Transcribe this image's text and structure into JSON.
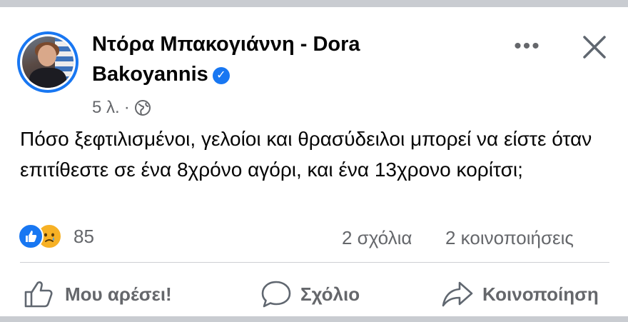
{
  "post": {
    "author_name": "Ντόρα Μπακογιάννη - Dora Bakoyannis",
    "timestamp": "5 λ.",
    "separator": "·",
    "privacy_icon": "globe-icon",
    "text": "Πόσο ξεφτιλισμένοι, γελοίοι και θρασύδειλοι μπορεί να είστε όταν επιτίθεστε σε ένα 8χρόνο αγόρι, και ένα 13χρονο κορίτσι;",
    "verified_icon": "verified-badge-icon"
  },
  "header_actions": {
    "more_icon": "more-options-icon",
    "more_glyph": "•••",
    "close_icon": "close-icon"
  },
  "stats": {
    "reactions": [
      "like-reaction-icon",
      "sad-reaction-icon"
    ],
    "reaction_count": "85",
    "comments": "2 σχόλια",
    "shares": "2 κοινοποιήσεις"
  },
  "actions": {
    "like_label": "Μου αρέσει!",
    "comment_label": "Σχόλιο",
    "share_label": "Κοινοποίηση"
  },
  "colors": {
    "accent": "#1877f2",
    "secondary_text": "#65676b",
    "sad_reaction": "#f7b125"
  }
}
